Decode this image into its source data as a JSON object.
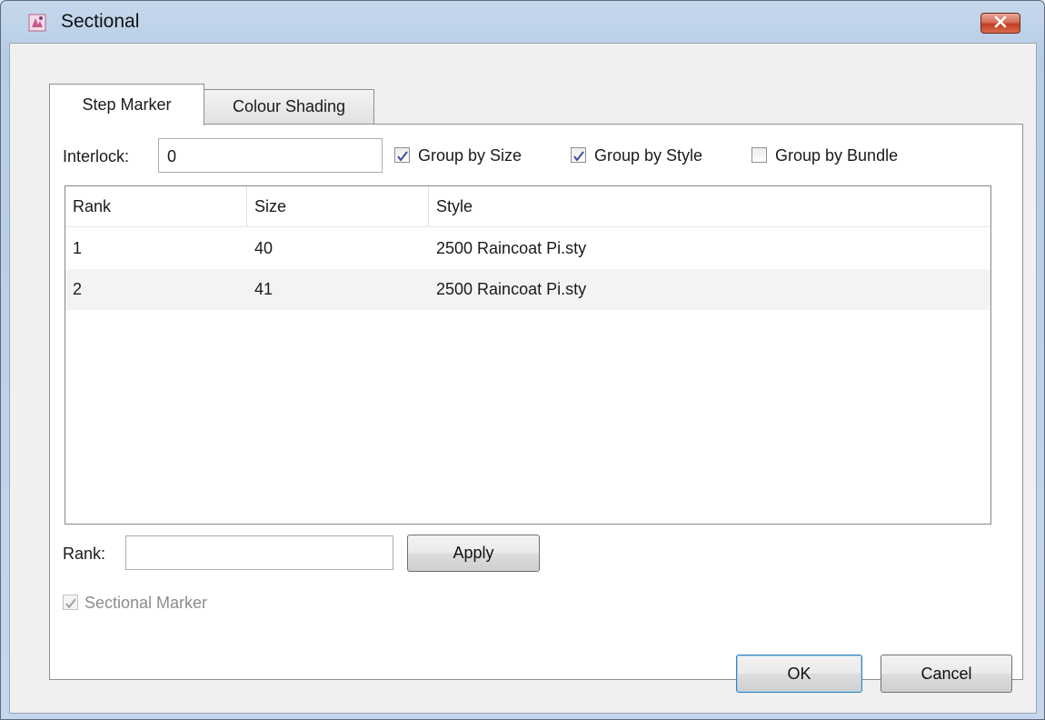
{
  "window": {
    "title": "Sectional"
  },
  "tabs": [
    {
      "label": "Step Marker",
      "active": true
    },
    {
      "label": "Colour Shading",
      "active": false
    }
  ],
  "interlock": {
    "label": "Interlock:",
    "value": "0"
  },
  "checkboxes": [
    {
      "label": "Group by Size",
      "checked": true
    },
    {
      "label": "Group by Style",
      "checked": true
    },
    {
      "label": "Group by Bundle",
      "checked": false
    }
  ],
  "table": {
    "columns": [
      "Rank",
      "Size",
      "Style"
    ],
    "rows": [
      [
        "1",
        "40",
        "2500 Raincoat Pi.sty"
      ],
      [
        "2",
        "41",
        "2500 Raincoat Pi.sty"
      ]
    ]
  },
  "rank": {
    "label": "Rank:",
    "value": "",
    "apply_label": "Apply"
  },
  "sectional_marker": {
    "label": "Sectional Marker",
    "checked": true,
    "disabled": true
  },
  "footer": {
    "ok_label": "OK",
    "cancel_label": "Cancel"
  },
  "colors": {
    "accent": "#3c7fb1",
    "close": "#c23d22",
    "row_alt": "#f3f3f3"
  },
  "icons": {
    "app": "app-icon",
    "close": "close-icon",
    "check": "checkmark-icon"
  }
}
